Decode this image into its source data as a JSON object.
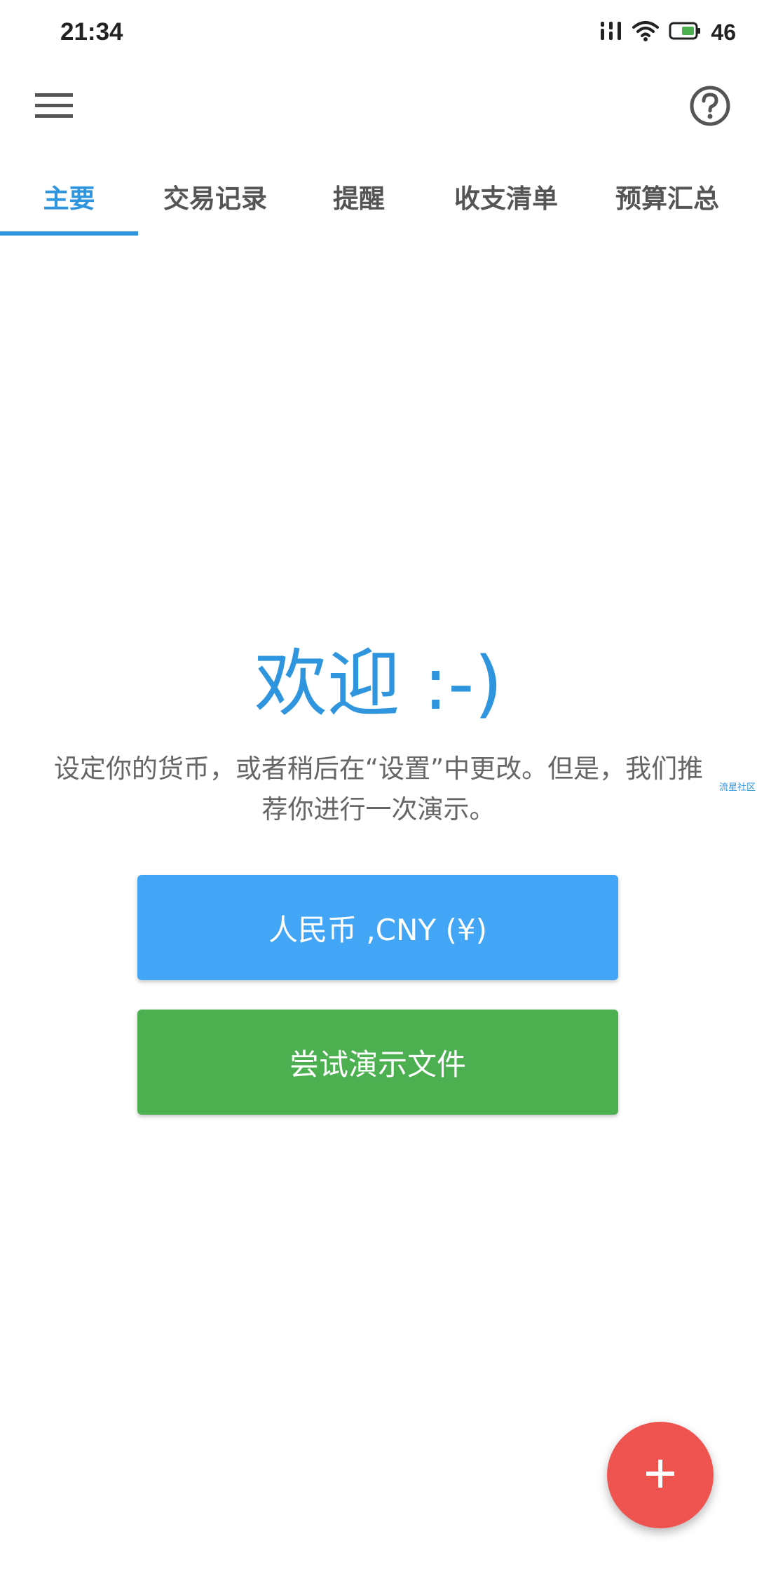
{
  "status_bar": {
    "time": "21:34",
    "battery_level": "46",
    "icons": [
      "signal-icon",
      "wifi-icon",
      "battery-icon"
    ]
  },
  "app_bar": {
    "menu_icon": "hamburger-menu-icon",
    "help_icon": "help-circle-icon"
  },
  "tabs": [
    {
      "label": "主要",
      "active": true
    },
    {
      "label": "交易记录",
      "active": false
    },
    {
      "label": "提醒",
      "active": false
    },
    {
      "label": "收支清单",
      "active": false
    },
    {
      "label": "预算汇总",
      "active": false
    }
  ],
  "main": {
    "title": "欢迎 :-)",
    "description": "设定你的货币，或者稍后在“设置”中更改。但是，我们推荐你进行一次演示。",
    "side_text": "流星社区",
    "currency_button": "人民币 ,CNY (¥)",
    "demo_button": "尝试演示文件"
  },
  "fab": {
    "icon": "plus-icon"
  },
  "colors": {
    "accent": "#2e95de",
    "currency_button": "#43a5f5",
    "demo_button": "#4caf50",
    "fab": "#ef5350"
  }
}
